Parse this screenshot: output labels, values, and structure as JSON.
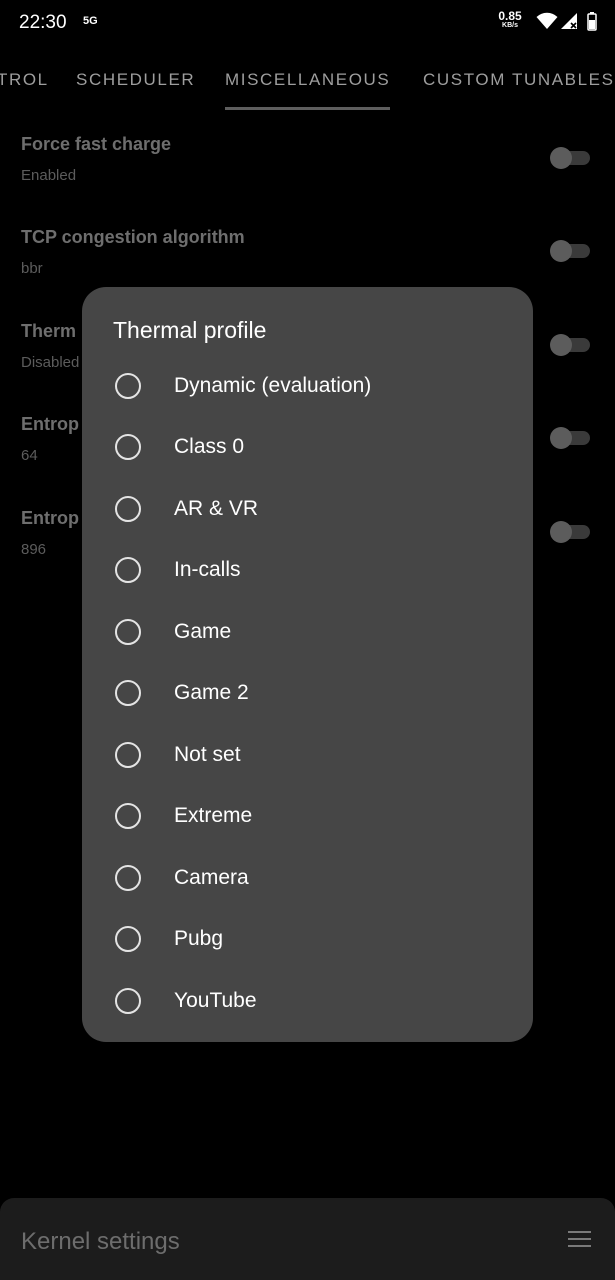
{
  "status_bar": {
    "time": "22:30",
    "network": "5G",
    "speed_value": "0.85",
    "speed_unit": "KB/s",
    "icons": [
      "wifi-icon",
      "cell-signal-icon",
      "battery-icon"
    ]
  },
  "tabs": [
    {
      "label": "TROL"
    },
    {
      "label": "SCHEDULER"
    },
    {
      "label": "MISCELLANEOUS",
      "active": true
    },
    {
      "label": "CUSTOM TUNABLES"
    }
  ],
  "settings": [
    {
      "title": "Force fast charge",
      "subtitle": "Enabled"
    },
    {
      "title": "TCP congestion algorithm",
      "subtitle": "bbr"
    },
    {
      "title": "Therm",
      "subtitle": "Disabled"
    },
    {
      "title": "Entrop",
      "subtitle": "64"
    },
    {
      "title": "Entrop",
      "subtitle": "896"
    }
  ],
  "dialog": {
    "title": "Thermal profile",
    "options": [
      {
        "label": "Dynamic (evaluation)",
        "selected": false
      },
      {
        "label": "Class 0",
        "selected": false
      },
      {
        "label": "AR & VR",
        "selected": false
      },
      {
        "label": "In-calls",
        "selected": false
      },
      {
        "label": "Game",
        "selected": false
      },
      {
        "label": "Game 2",
        "selected": false
      },
      {
        "label": "Not set",
        "selected": false
      },
      {
        "label": "Extreme",
        "selected": false
      },
      {
        "label": "Camera",
        "selected": false
      },
      {
        "label": "Pubg",
        "selected": false
      },
      {
        "label": "YouTube",
        "selected": false
      }
    ]
  },
  "bottom_bar": {
    "title": "Kernel settings",
    "menu_icon": "hamburger-menu-icon"
  },
  "colors": {
    "background": "#000000",
    "dialog_bg": "#464646",
    "bottom_bar_bg": "#1c1c1c"
  }
}
